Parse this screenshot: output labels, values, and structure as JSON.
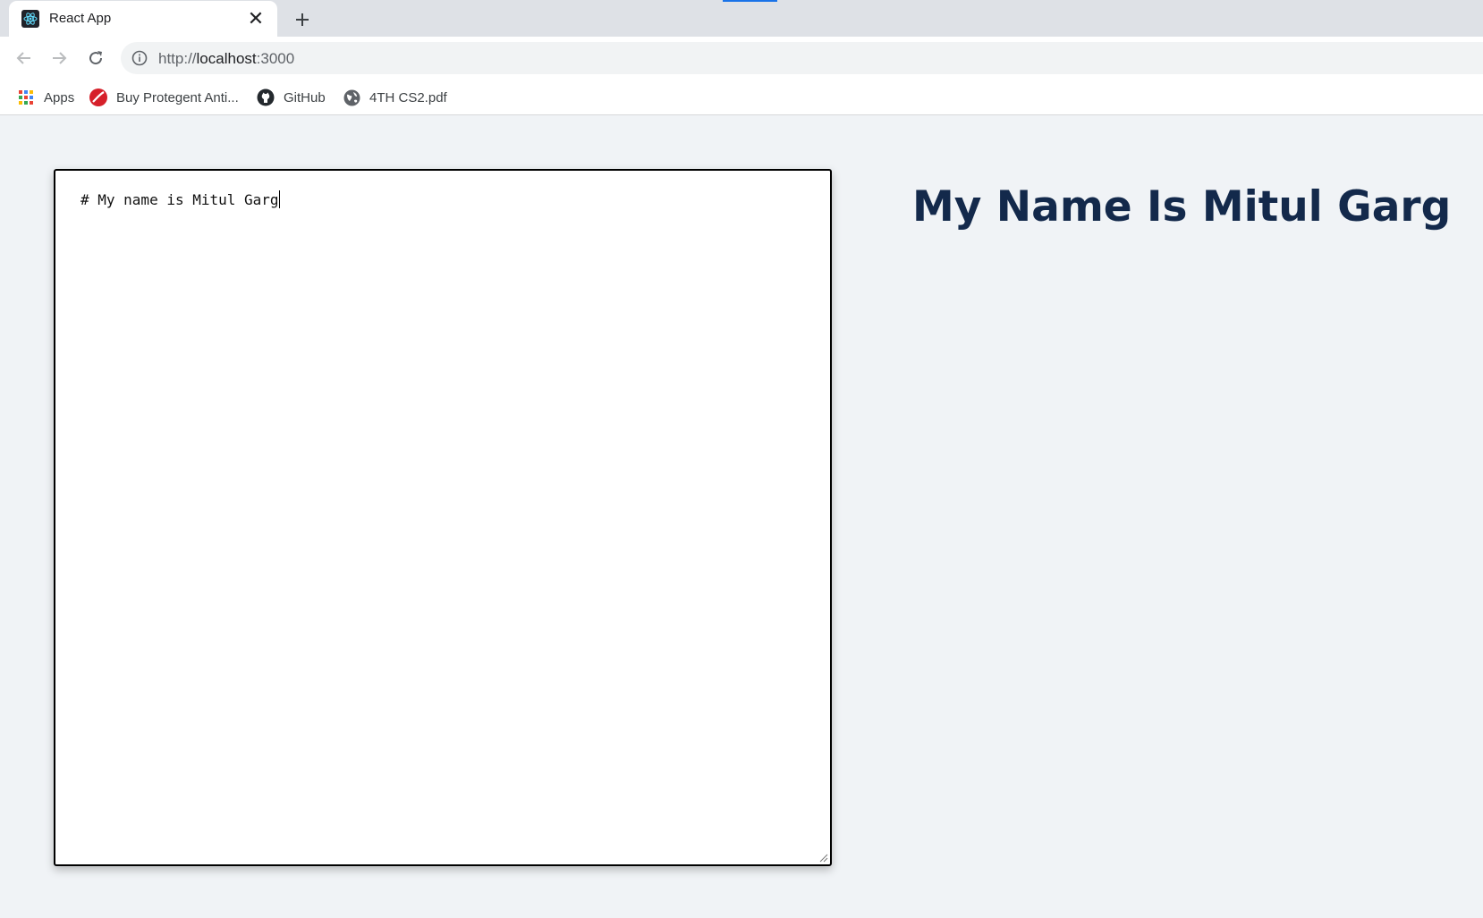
{
  "browser": {
    "tab": {
      "title": "React App",
      "close_glyph": "✕"
    },
    "new_tab_glyph": "+",
    "address": {
      "protocol": "http://",
      "host": "localhost",
      "port": ":3000"
    },
    "accent_color": "#1a73e8",
    "bookmarks": [
      {
        "label": "Apps",
        "icon": "apps-grid-icon"
      },
      {
        "label": "Buy Protegent Anti...",
        "icon": "protegent-icon"
      },
      {
        "label": "GitHub",
        "icon": "github-icon"
      },
      {
        "label": "4TH CS2.pdf",
        "icon": "globe-icon"
      }
    ]
  },
  "editor": {
    "value": "# My name is Mitul Garg"
  },
  "preview": {
    "heading": "My Name Is Mitul Garg",
    "heading_color": "#13294b"
  }
}
